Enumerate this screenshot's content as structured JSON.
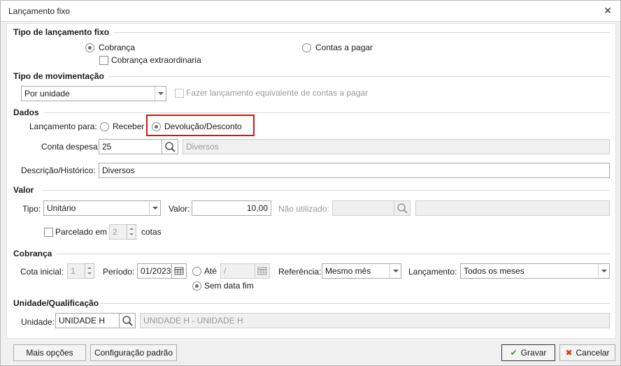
{
  "window": {
    "title": "Lançamento fixo",
    "close_glyph": "✕"
  },
  "tipo_lancamento": {
    "title": "Tipo de lançamento fixo",
    "cobranca": "Cobrança",
    "contas_pagar": "Contas a pagar",
    "cobranca_extra": "Cobrança extraordinaria"
  },
  "movimentacao": {
    "title": "Tipo de movimentação",
    "selected": "Por unidade",
    "equivalente": "Fazer lançamento equivalente de contas a pagar"
  },
  "dados": {
    "title": "Dados",
    "lancamento_para_label": "Lançamento para:",
    "receber": "Receber",
    "devolucao": "Devolução/Desconto",
    "conta_label": "Conta despesa:",
    "conta_value": "25",
    "conta_desc": "Diversos",
    "descricao_label": "Descrição/Histórico:",
    "descricao_value": "Diversos"
  },
  "valor": {
    "title": "Valor",
    "tipo_label": "Tipo:",
    "tipo_value": "Unitário",
    "valor_label": "Valor:",
    "valor_value": "10,00",
    "nao_utilizado_label": "Não utilizado:",
    "parcelado_label": "Parcelado em",
    "parcelas_value": "2",
    "cotas_label": "cotas"
  },
  "cobranca": {
    "title": "Cobrança",
    "cota_inicial_label": "Cota inicial:",
    "cota_inicial_value": "1",
    "periodo_label": "Período:",
    "periodo_value": "01/2023",
    "ate_label": "Até",
    "ate_value": "/",
    "sem_data_fim": "Sem data fim",
    "referencia_label": "Referência:",
    "referencia_value": "Mesmo mês",
    "lancamento_label": "Lançamento:",
    "lancamento_value": "Todos os meses"
  },
  "unidade": {
    "title": "Unidade/Qualificação",
    "label": "Unidade:",
    "value": "UNIDADE H",
    "desc": "UNIDADE H - UNIDADE H"
  },
  "buttons": {
    "mais_opcoes": "Mais opções",
    "config_padrao": "Configuração padrão",
    "gravar": "Gravar",
    "cancelar": "Cancelar"
  },
  "colors": {
    "highlight": "#e01010",
    "gravar_icon": "#3a9a2a",
    "cancelar_icon": "#d83a1a"
  }
}
